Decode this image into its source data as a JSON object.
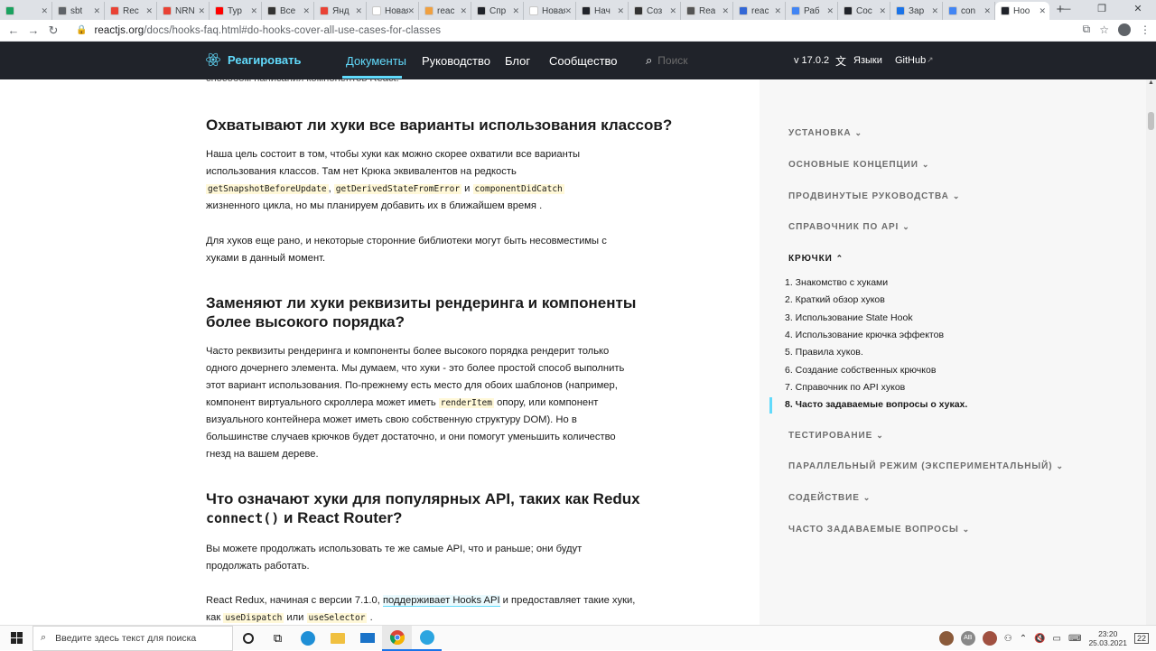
{
  "browser": {
    "tabs": [
      {
        "label": "",
        "color": "#1aa260"
      },
      {
        "label": "sbt",
        "color": "#5f6368"
      },
      {
        "label": "Rec",
        "color": "#e94235"
      },
      {
        "label": "NRN",
        "color": "#e94235"
      },
      {
        "label": "Тур",
        "color": "#ff0000"
      },
      {
        "label": "Все",
        "color": "#333333"
      },
      {
        "label": "Янд",
        "color": "#e94235"
      },
      {
        "label": "Новая",
        "color": "#ffffff"
      },
      {
        "label": "reac",
        "color": "#f0a040"
      },
      {
        "label": "Спр",
        "color": "#20232a"
      },
      {
        "label": "Новая",
        "color": "#ffffff"
      },
      {
        "label": "Нач",
        "color": "#20232a"
      },
      {
        "label": "Соз",
        "color": "#333333"
      },
      {
        "label": "Rea",
        "color": "#555555"
      },
      {
        "label": "reac",
        "color": "#3367d6"
      },
      {
        "label": "Раб",
        "color": "#4285f4"
      },
      {
        "label": "Сос",
        "color": "#20232a"
      },
      {
        "label": "Зар",
        "color": "#1a73e8"
      },
      {
        "label": "con",
        "color": "#4285f4"
      },
      {
        "label": "Hoo",
        "color": "#20232a"
      }
    ],
    "new_tab": "+",
    "url_host": "reactjs.org",
    "url_path": "/docs/hooks-faq.html#do-hooks-cover-all-use-cases-for-classes"
  },
  "nav": {
    "brand": "Реагировать",
    "links": [
      "Документы",
      "Руководство",
      "Блог",
      "Сообщество"
    ],
    "search_placeholder": "Поиск",
    "version": "v 17.0.2",
    "languages": "Языки",
    "github": "GitHub"
  },
  "content": {
    "top_fragment": "способом написания компонентов React.",
    "h1": "Охватывают ли хуки все варианты использования классов?",
    "p1_a": "Наша цель состоит в том, чтобы хуки как можно скорее охватили все варианты использования классов. Там нет Крюка эквивалентов на редкость ",
    "p1_code1": "getSnapshotBeforeUpdate",
    "p1_sep1": ", ",
    "p1_code2": "getDerivedStateFromError",
    "p1_sep2": " и ",
    "p1_code3": "componentDidCatch",
    "p1_b": " жизненного цикла, но мы планируем добавить их в ближайшем время .",
    "p2": "Для хуков еще рано, и некоторые сторонние библиотеки могут быть несовместимы с хуками в данный момент.",
    "h2": "Заменяют ли хуки реквизиты рендеринга и компоненты более высокого порядка?",
    "p3_a": "Часто реквизиты рендеринга и компоненты более высокого порядка рендерит только одного дочернего элемента. Мы думаем, что хуки - это более простой способ выполнить этот вариант использования. По-прежнему есть место для обоих шаблонов (например, компонент виртуального скроллера может иметь ",
    "p3_code": "renderItem",
    "p3_b": " опору, или компонент визуального контейнера может иметь свою собственную структуру DOM). Но в большинстве случаев крючков будет достаточно, и они помогут уменьшить количество гнезд на вашем дереве.",
    "h3_a": "Что означают хуки для популярных API, таких как Redux ",
    "h3_code": "connect()",
    "h3_b": " и React Router?",
    "p4": "Вы можете продолжать использовать те же самые API, что и раньше; они будут продолжать работать.",
    "p5_a": "React Redux, начиная с версии 7.1.0, ",
    "p5_link": "поддерживает Hooks API",
    "p5_b": " и предоставляет такие хуки, как ",
    "p5_code1": "useDispatch",
    "p5_sep": " или ",
    "p5_code2": "useSelector",
    "p5_c": " ."
  },
  "sidebar": {
    "sections_top": [
      {
        "label": "УСТАНОВКА",
        "chevron": "⌄"
      },
      {
        "label": "ОСНОВНЫЕ КОНЦЕПЦИИ",
        "chevron": "⌄"
      },
      {
        "label": "ПРОДВИНУТЫЕ РУКОВОДСТВА",
        "chevron": "⌄"
      },
      {
        "label": "СПРАВОЧНИК ПО API",
        "chevron": "⌄"
      }
    ],
    "open_section": {
      "label": "КРЮЧКИ",
      "chevron": "⌃"
    },
    "items": [
      "1. Знакомство с хуками",
      "2. Краткий обзор хуков",
      "3. Использование State Hook",
      "4. Использование крючка эффектов",
      "5. Правила хуков.",
      "6. Создание собственных крючков",
      "7. Справочник по API хуков",
      "8. Часто задаваемые вопросы о хуках."
    ],
    "active_item": 7,
    "sections_bottom": [
      {
        "label": "ТЕСТИРОВАНИЕ",
        "chevron": "⌄"
      },
      {
        "label": "ПАРАЛЛЕЛЬНЫЙ РЕЖИМ (ЭКСПЕРИМЕНТАЛЬНЫЙ)",
        "chevron": "⌄"
      },
      {
        "label": "СОДЕЙСТВИЕ",
        "chevron": "⌄"
      },
      {
        "label": "ЧАСТО ЗАДАВАЕМЫЕ ВОПРОСЫ",
        "chevron": "⌄"
      }
    ]
  },
  "taskbar": {
    "search_placeholder": "Введите здесь текст для поиска",
    "tray_badge": "AB",
    "time": "23:20",
    "date": "25.03.2021",
    "notif_count": "22"
  },
  "colors": {
    "react_blue": "#61dafb",
    "nav_bg": "#20232a",
    "sidebar_bg": "#f7f7f7"
  }
}
